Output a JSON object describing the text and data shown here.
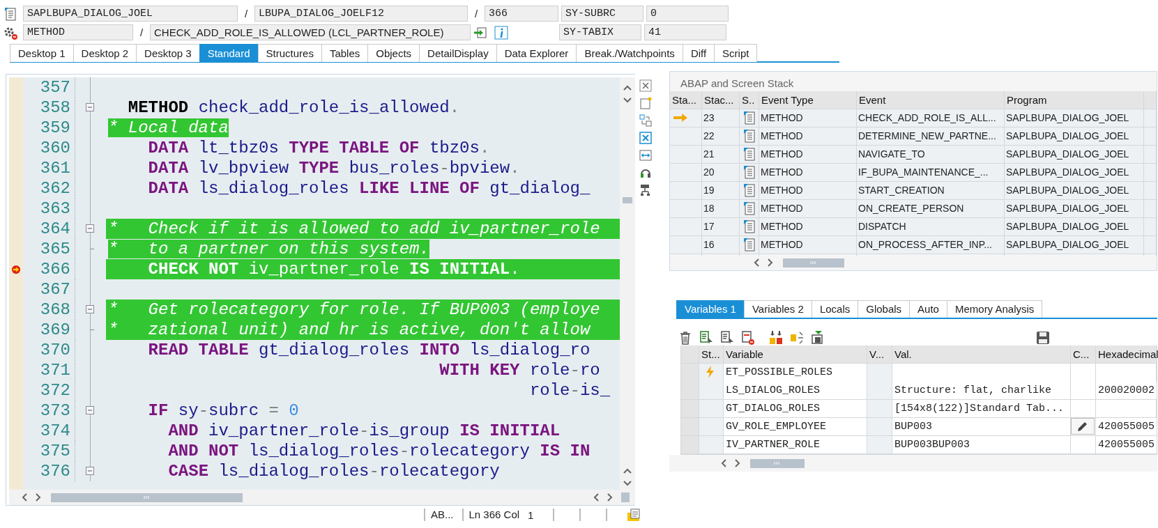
{
  "context": {
    "program": "SAPLBUPA_DIALOG_JOEL",
    "separator_1": "/",
    "include": "LBUPA_DIALOG_JOELF12",
    "separator_2": "/",
    "line": "366",
    "field_1_name": "SY-SUBRC",
    "field_1_value": "0",
    "event_type": "METHOD",
    "separator_3": "/",
    "event": "CHECK_ADD_ROLE_IS_ALLOWED (LCL_PARTNER_ROLE)",
    "field_2_name": "SY-TABIX",
    "field_2_value": "41"
  },
  "tabs": [
    {
      "label": "Desktop 1",
      "selected": false
    },
    {
      "label": "Desktop 2",
      "selected": false
    },
    {
      "label": "Desktop 3",
      "selected": false
    },
    {
      "label": "Standard",
      "selected": true
    },
    {
      "label": "Structures",
      "selected": false
    },
    {
      "label": "Tables",
      "selected": false
    },
    {
      "label": "Objects",
      "selected": false
    },
    {
      "label": "DetailDisplay",
      "selected": false
    },
    {
      "label": "Data Explorer",
      "selected": false
    },
    {
      "label": "Break./Watchpoints",
      "selected": false
    },
    {
      "label": "Diff",
      "selected": false
    },
    {
      "label": "Script",
      "selected": false
    }
  ],
  "editor": {
    "lines": [
      {
        "number": "357",
        "kind": "plain",
        "breakpoint": false,
        "highlight": false
      },
      {
        "number": "358",
        "kind": "opener",
        "breakpoint": false,
        "highlight": false,
        "tokens": [
          {
            "t": "  METHOD",
            "kind": "method"
          },
          {
            "t": " check_add_role_is_allowed",
            "kind": "id"
          },
          {
            "t": ".",
            "kind": "op"
          }
        ]
      },
      {
        "number": "359",
        "kind": "plain",
        "breakpoint": false,
        "highlight": false,
        "tokens": [
          {
            "t": "* Local data",
            "kind": "comment"
          }
        ]
      },
      {
        "number": "360",
        "kind": "plain",
        "breakpoint": false,
        "highlight": false,
        "tokens": [
          {
            "t": "    DATA",
            "kind": "kw"
          },
          {
            "t": " lt_tbz0s",
            "kind": "id"
          },
          {
            "t": " TYPE TABLE OF",
            "kind": "kw"
          },
          {
            "t": " tbz0s",
            "kind": "id"
          },
          {
            "t": ".",
            "kind": "op"
          }
        ]
      },
      {
        "number": "361",
        "kind": "plain",
        "breakpoint": false,
        "highlight": false,
        "tokens": [
          {
            "t": "    DATA",
            "kind": "kw"
          },
          {
            "t": " lv_bpview",
            "kind": "id"
          },
          {
            "t": " TYPE",
            "kind": "kw"
          },
          {
            "t": " bus_roles",
            "kind": "id"
          },
          {
            "t": "-",
            "kind": "op"
          },
          {
            "t": "bpview",
            "kind": "id"
          },
          {
            "t": ".",
            "kind": "op"
          }
        ]
      },
      {
        "number": "362",
        "kind": "plain",
        "breakpoint": false,
        "highlight": false,
        "tokens": [
          {
            "t": "    DATA",
            "kind": "kw"
          },
          {
            "t": " ls_dialog_roles",
            "kind": "id"
          },
          {
            "t": " LIKE LINE OF",
            "kind": "kw"
          },
          {
            "t": " gt_dialog_",
            "kind": "id"
          }
        ]
      },
      {
        "number": "363",
        "kind": "plain",
        "breakpoint": false,
        "highlight": false
      },
      {
        "number": "364",
        "kind": "opener",
        "breakpoint": false,
        "highlight": true,
        "tokens": [
          {
            "t": "*   Check if it is allowed to add iv_partner_role",
            "kind": "comment"
          }
        ]
      },
      {
        "number": "365",
        "kind": "closer",
        "breakpoint": false,
        "highlight": false,
        "tokens": [
          {
            "t": "*   to a partner on this system.",
            "kind": "comment"
          }
        ]
      },
      {
        "number": "366",
        "kind": "plain",
        "breakpoint": true,
        "highlight": true,
        "tokens": [
          {
            "t": "    CHECK NOT",
            "kind": "kw"
          },
          {
            "t": " iv_partner_role",
            "kind": "id"
          },
          {
            "t": " IS INITIAL",
            "kind": "kw"
          },
          {
            "t": ".",
            "kind": "op"
          }
        ]
      },
      {
        "number": "367",
        "kind": "plain",
        "breakpoint": false,
        "highlight": false
      },
      {
        "number": "368",
        "kind": "opener",
        "breakpoint": false,
        "highlight": true,
        "tokens": [
          {
            "t": "*   Get rolecategory for role. If BUP003 (employe",
            "kind": "comment"
          }
        ]
      },
      {
        "number": "369",
        "kind": "closer",
        "breakpoint": false,
        "highlight": true,
        "tokens": [
          {
            "t": "*   zational unit) and hr is active, don't allow",
            "kind": "comment"
          }
        ]
      },
      {
        "number": "370",
        "kind": "plain",
        "breakpoint": false,
        "highlight": false,
        "tokens": [
          {
            "t": "    READ TABLE",
            "kind": "kw"
          },
          {
            "t": " gt_dialog_roles",
            "kind": "id"
          },
          {
            "t": " INTO",
            "kind": "kw"
          },
          {
            "t": " ls_dialog_ro",
            "kind": "id"
          }
        ]
      },
      {
        "number": "371",
        "kind": "plain",
        "breakpoint": false,
        "highlight": false,
        "tokens": [
          {
            "t": "                                 WITH KEY",
            "kind": "kw"
          },
          {
            "t": " role",
            "kind": "id"
          },
          {
            "t": "-",
            "kind": "op"
          },
          {
            "t": "ro",
            "kind": "id"
          }
        ]
      },
      {
        "number": "372",
        "kind": "plain",
        "breakpoint": false,
        "highlight": false,
        "tokens": [
          {
            "t": "                                          role",
            "kind": "id"
          },
          {
            "t": "-",
            "kind": "op"
          },
          {
            "t": "is_",
            "kind": "id"
          }
        ]
      },
      {
        "number": "373",
        "kind": "opener",
        "breakpoint": false,
        "highlight": false,
        "tokens": [
          {
            "t": "    IF",
            "kind": "kw"
          },
          {
            "t": " sy",
            "kind": "id"
          },
          {
            "t": "-",
            "kind": "op"
          },
          {
            "t": "subrc",
            "kind": "id"
          },
          {
            "t": " =",
            "kind": "op"
          },
          {
            "t": " 0",
            "kind": "num"
          }
        ]
      },
      {
        "number": "374",
        "kind": "plain",
        "breakpoint": false,
        "highlight": false,
        "tokens": [
          {
            "t": "      AND",
            "kind": "kw"
          },
          {
            "t": " iv_partner_role",
            "kind": "id"
          },
          {
            "t": "-",
            "kind": "op"
          },
          {
            "t": "is_group",
            "kind": "id"
          },
          {
            "t": " IS INITIAL",
            "kind": "kw"
          }
        ]
      },
      {
        "number": "375",
        "kind": "plain",
        "breakpoint": false,
        "highlight": false,
        "tokens": [
          {
            "t": "      AND NOT",
            "kind": "kw"
          },
          {
            "t": " ls_dialog_roles",
            "kind": "id"
          },
          {
            "t": "-",
            "kind": "op"
          },
          {
            "t": "rolecategory",
            "kind": "id"
          },
          {
            "t": " IS IN",
            "kind": "kw"
          }
        ]
      },
      {
        "number": "376",
        "kind": "opener",
        "breakpoint": false,
        "highlight": false,
        "tokens": [
          {
            "t": "      CASE",
            "kind": "kw"
          },
          {
            "t": " ls_dialog_roles",
            "kind": "id"
          },
          {
            "t": "-",
            "kind": "op"
          },
          {
            "t": "rolecategory",
            "kind": "id"
          }
        ]
      }
    ]
  },
  "status_bar": {
    "mode": "AB...",
    "position": "Ln 366 Col",
    "column": "1"
  },
  "stack": {
    "title": "ABAP and Screen Stack",
    "columns": [
      "Sta...",
      "Stac...",
      "S..",
      "Event Type",
      "Event",
      "Program"
    ],
    "rows": [
      {
        "current": true,
        "stack_no": "23",
        "event_type": "METHOD",
        "event": "CHECK_ADD_ROLE_IS_ALL...",
        "program": "SAPLBUPA_DIALOG_JOEL"
      },
      {
        "current": false,
        "stack_no": "22",
        "event_type": "METHOD",
        "event": "DETERMINE_NEW_PARTNE...",
        "program": "SAPLBUPA_DIALOG_JOEL"
      },
      {
        "current": false,
        "stack_no": "21",
        "event_type": "METHOD",
        "event": "NAVIGATE_TO",
        "program": "SAPLBUPA_DIALOG_JOEL"
      },
      {
        "current": false,
        "stack_no": "20",
        "event_type": "METHOD",
        "event": "IF_BUPA_MAINTENANCE_...",
        "program": "SAPLBUPA_DIALOG_JOEL"
      },
      {
        "current": false,
        "stack_no": "19",
        "event_type": "METHOD",
        "event": "START_CREATION",
        "program": "SAPLBUPA_DIALOG_JOEL"
      },
      {
        "current": false,
        "stack_no": "18",
        "event_type": "METHOD",
        "event": "ON_CREATE_PERSON",
        "program": "SAPLBUPA_DIALOG_JOEL"
      },
      {
        "current": false,
        "stack_no": "17",
        "event_type": "METHOD",
        "event": "DISPATCH",
        "program": "SAPLBUPA_DIALOG_JOEL"
      },
      {
        "current": false,
        "stack_no": "16",
        "event_type": "METHOD",
        "event": "ON_PROCESS_AFTER_INP...",
        "program": "SAPLBUPA_DIALOG_JOEL"
      }
    ]
  },
  "variables": {
    "tabs": [
      {
        "label": "Variables 1",
        "selected": true
      },
      {
        "label": "Variables 2",
        "selected": false
      },
      {
        "label": "Locals",
        "selected": false
      },
      {
        "label": "Globals",
        "selected": false
      },
      {
        "label": "Auto",
        "selected": false
      },
      {
        "label": "Memory Analysis",
        "selected": false
      }
    ],
    "columns": [
      "St...",
      "Variable",
      "V...",
      "Val.",
      "C...",
      "Hexadecimal"
    ],
    "rows": [
      {
        "flag": true,
        "variable": "ET_POSSIBLE_ROLES",
        "editable": false
      },
      {
        "flag": false,
        "variable": "LS_DIALOG_ROLES",
        "value": "Structure: flat, charlike",
        "editable": false,
        "hex": "200020002"
      },
      {
        "flag": false,
        "variable": "GT_DIALOG_ROLES",
        "value": "[154x8(122)]Standard Tab...",
        "editable": false
      },
      {
        "flag": false,
        "variable": "GV_ROLE_EMPLOYEE",
        "value": "BUP003",
        "editable": true,
        "hex": "420055005"
      },
      {
        "flag": false,
        "variable": "IV_PARTNER_ROLE",
        "value": "BUP003BUP003",
        "editable": false,
        "hex": "420055005"
      }
    ]
  }
}
